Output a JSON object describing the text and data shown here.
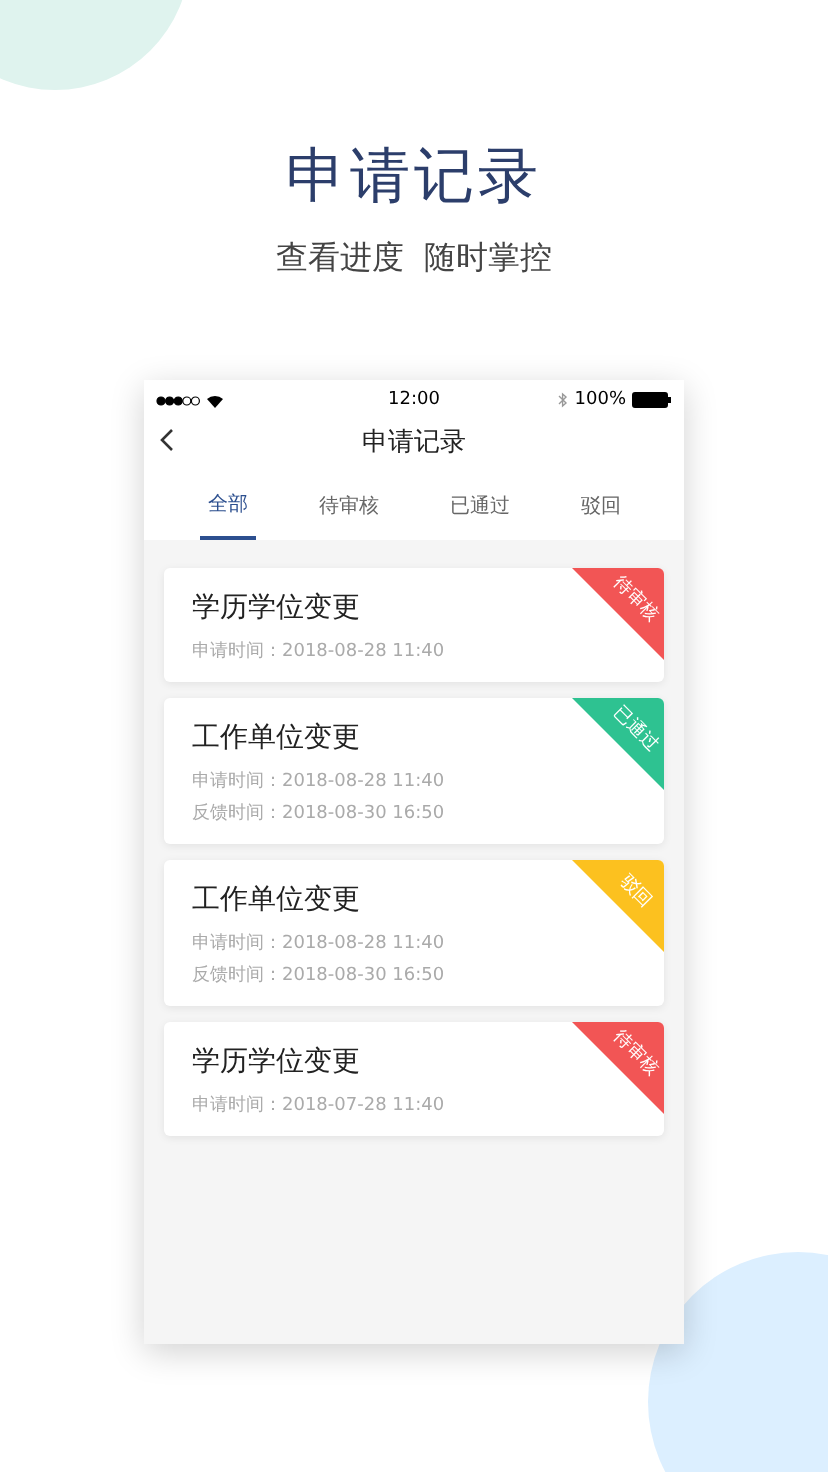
{
  "hero": {
    "title": "申请记录",
    "subtitle": "查看进度  随时掌控"
  },
  "status_bar": {
    "time": "12:00",
    "battery": "100%"
  },
  "nav": {
    "title": "申请记录"
  },
  "tabs": [
    {
      "label": "全部",
      "selected": true
    },
    {
      "label": "待审核",
      "selected": false
    },
    {
      "label": "已通过",
      "selected": false
    },
    {
      "label": "驳回",
      "selected": false
    }
  ],
  "records": [
    {
      "title": "学历学位变更",
      "lines": [
        "申请时间：2018-08-28 11:40"
      ],
      "status": "待审核",
      "color": "#f25555"
    },
    {
      "title": "工作单位变更",
      "lines": [
        "申请时间：2018-08-28 11:40",
        "反馈时间：2018-08-30 16:50"
      ],
      "status": "已通过",
      "color": "#2ec291"
    },
    {
      "title": "工作单位变更",
      "lines": [
        "申请时间：2018-08-28 11:40",
        "反馈时间：2018-08-30 16:50"
      ],
      "status": "驳回",
      "color": "#fcc11f"
    },
    {
      "title": "学历学位变更",
      "lines": [
        "申请时间：2018-07-28 11:40"
      ],
      "status": "待审核",
      "color": "#f25555"
    }
  ]
}
